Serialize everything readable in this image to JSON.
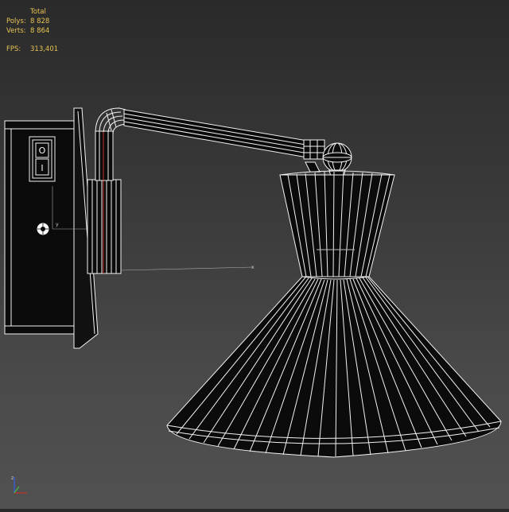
{
  "stats": {
    "header": "Total",
    "polys_label": "Polys:",
    "polys_value": "8 828",
    "verts_label": "Verts:",
    "verts_value": "8 864",
    "fps_label": "FPS:",
    "fps_value": "313,401"
  },
  "switch": {
    "on_label": "O",
    "off_label": "I"
  },
  "axes": {
    "y_label": "y",
    "x_label": "x",
    "z_label": "z"
  },
  "colors": {
    "wire": "#f2f2f2",
    "fill": "#0b0b0b",
    "stats_text": "#e8c454",
    "axis_red": "#c8302a",
    "axis_green": "#3fbf3f",
    "axis_blue": "#3a5ee8"
  }
}
